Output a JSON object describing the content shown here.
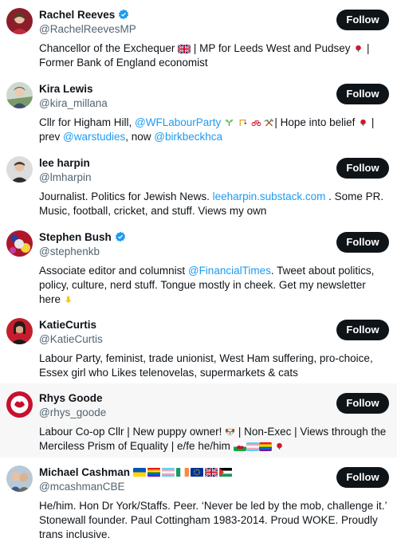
{
  "follow_label": "Follow",
  "accounts": [
    {
      "name": "Rachel Reeves",
      "handle": "@RachelReevesMP",
      "bio": [
        "Chancellor of the Exchequer ",
        {
          "emoji": "uk-flag"
        },
        " | MP for Leeds West and Pudsey ",
        {
          "emoji": "rose"
        },
        " | Former Bank of England economist"
      ],
      "verified": true
    },
    {
      "name": "Kira Lewis",
      "handle": "@kira_millana",
      "bio": [
        "Cllr for Higham Hill, ",
        {
          "link": "@WFLabourParty"
        },
        " ",
        {
          "emoji": "seedling"
        },
        " ",
        {
          "emoji": "crane"
        },
        " ",
        {
          "emoji": "bicycle"
        },
        " ",
        {
          "emoji": "hammer-pick"
        },
        "| Hope into belief ",
        {
          "emoji": "rose"
        },
        " | prev ",
        {
          "link": "@warstudies"
        },
        ", now ",
        {
          "link": "@birkbeckhca"
        }
      ],
      "verified": false
    },
    {
      "name": "lee harpin",
      "handle": "@lmharpin",
      "bio": [
        "Journalist. Politics for Jewish News. ",
        {
          "link": "leeharpin.substack.com"
        },
        " . Some PR. Music, football, cricket, and stuff. Views my own"
      ],
      "verified": false
    },
    {
      "name": "Stephen Bush",
      "handle": "@stephenkb",
      "bio": [
        "Associate editor and columnist ",
        {
          "link": "@FinancialTimes"
        },
        ". Tweet about politics, policy, culture, nerd stuff. Tongue mostly in cheek. Get my newsletter here ",
        {
          "emoji": "point-down"
        }
      ],
      "verified": true
    },
    {
      "name": "KatieCurtis",
      "handle": "@KatieCurtis",
      "bio": [
        "Labour Party, feminist, trade unionist, West Ham suffering, pro-choice, Essex girl who Likes telenovelas, supermarkets & cats"
      ],
      "verified": false
    },
    {
      "name": "Rhys Goode",
      "handle": "@rhys_goode",
      "bio": [
        "Labour Co-op Cllr | New puppy owner! ",
        {
          "emoji": "dog"
        },
        " | Non-Exec | Views through the Merciless Prism of Equality | e/fe he/him ",
        {
          "emoji": "wales-flag"
        },
        {
          "emoji": "trans-flag"
        },
        {
          "emoji": "rainbow-flag"
        },
        " ",
        {
          "emoji": "rose"
        }
      ],
      "verified": false
    },
    {
      "name": "Michael Cashman",
      "handle": "@mcashmanCBE",
      "bio": [
        "He/him. Hon Dr York/Staffs. Peer. ‘Never be led by the mob, challenge it.’ Stonewall founder. Paul Cottingham 1983-2014. Proud WOKE. Proudly trans inclusive."
      ],
      "verified": false,
      "name_flags": [
        "ukraine-flag",
        "rainbow-flag",
        "trans-flag",
        "ireland-flag",
        "eu-flag",
        "uk-flag",
        "palestine-flag"
      ]
    }
  ],
  "colors": {
    "text": "#0f1419",
    "secondary": "#536471",
    "link": "#1d9bf0",
    "verified": "#1d9bf0",
    "button_bg": "#0f1419",
    "button_text": "#ffffff",
    "highlight_row": "#f7f7f7"
  }
}
